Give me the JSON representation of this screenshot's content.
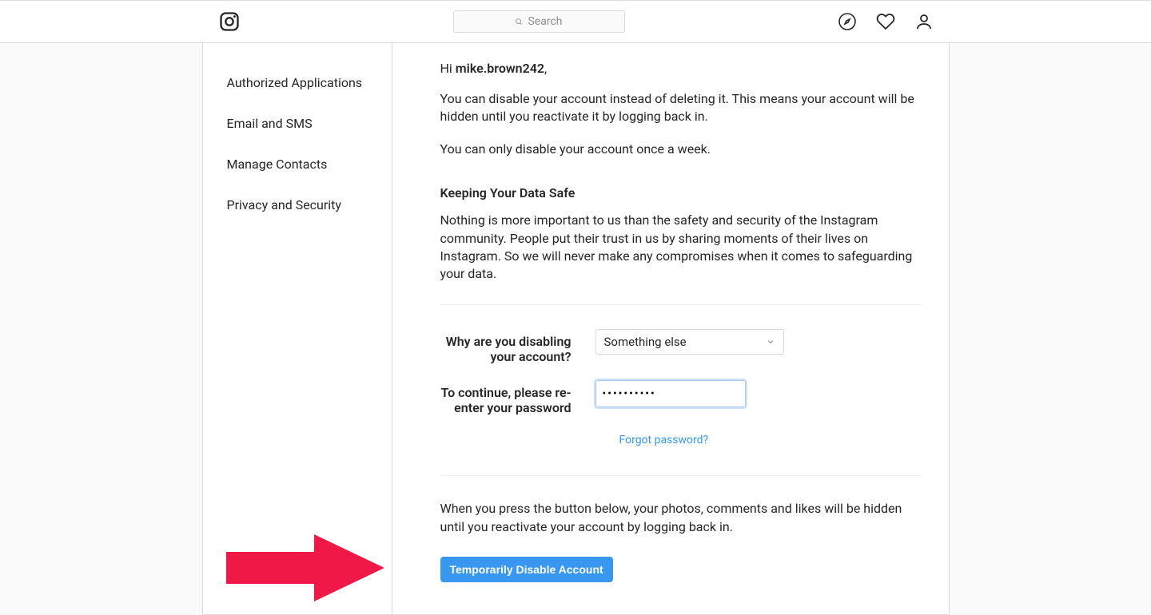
{
  "header": {
    "search_placeholder": "Search"
  },
  "sidebar": {
    "items": [
      {
        "label": "Authorized Applications"
      },
      {
        "label": "Email and SMS"
      },
      {
        "label": "Manage Contacts"
      },
      {
        "label": "Privacy and Security"
      }
    ]
  },
  "main": {
    "greeting_prefix": "Hi ",
    "username": "mike.brown242",
    "greeting_suffix": ",",
    "intro_para": "You can disable your account instead of deleting it. This means your account will be hidden until you reactivate it by logging back in.",
    "limit_para": "You can only disable your account once a week.",
    "safe_heading": "Keeping Your Data Safe",
    "safe_para": "Nothing is more important to us than the safety and security of the Instagram community. People put their trust in us by sharing moments of their lives on Instagram. So we will never make any compromises when it comes to safeguarding your data.",
    "reason_label": "Why are you disabling your account?",
    "reason_value": "Something else",
    "password_label": "To continue, please re-enter your password",
    "password_value": "••••••••••",
    "forgot_link": "Forgot password?",
    "note_para": "When you press the button below, your photos, comments and likes will be hidden until you reactivate your account by logging back in.",
    "submit_label": "Temporarily Disable Account"
  },
  "colors": {
    "accent": "#3897f0",
    "arrow": "#ef1846"
  }
}
